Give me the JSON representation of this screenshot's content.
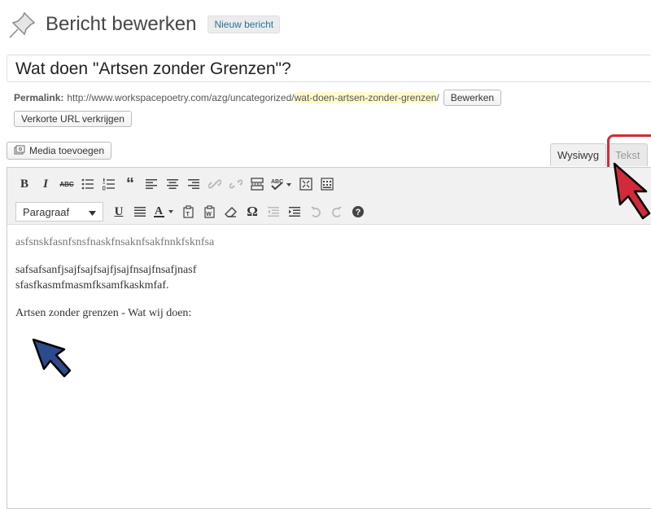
{
  "header": {
    "title": "Bericht bewerken",
    "new_post_label": "Nieuw bericht"
  },
  "post": {
    "title": "Wat doen \"Artsen zonder Grenzen\"?",
    "permalink_label": "Permalink:",
    "permalink_base": "http://www.workspacepoetry.com/azg/uncategorized/",
    "permalink_slug": "wat-doen-artsen-zonder-grenzen",
    "permalink_trailing": "/",
    "edit_label": "Bewerken",
    "shortlink_label": "Verkorte URL verkrijgen"
  },
  "media": {
    "add_label": "Media toevoegen"
  },
  "tabs": {
    "visual": "Wysiwyg",
    "text": "Tekst"
  },
  "toolbar": {
    "format_selected": "Paragraaf",
    "bold": "B",
    "italic": "I",
    "strike": "ABC",
    "underline": "U",
    "textcolor": "A",
    "omega": "Ω"
  },
  "content": {
    "paragraphs": [
      "asfsnskfasnfsnsfnaskfnsaknfsakfnnkfsknfsa",
      "safsafsanfjsajfsajfsajfjsajfnsajfnsafjnasf",
      "sfasfkasmfmasmfksamfkaskmfaf.",
      "Artsen zonder grenzen - Wat wij doen:"
    ]
  },
  "colors": {
    "highlight_box": "#d22a3b",
    "red_cursor": "#d22a3b",
    "blue_cursor": "#2e4a8e",
    "slug_highlight": "#fffbcc"
  }
}
